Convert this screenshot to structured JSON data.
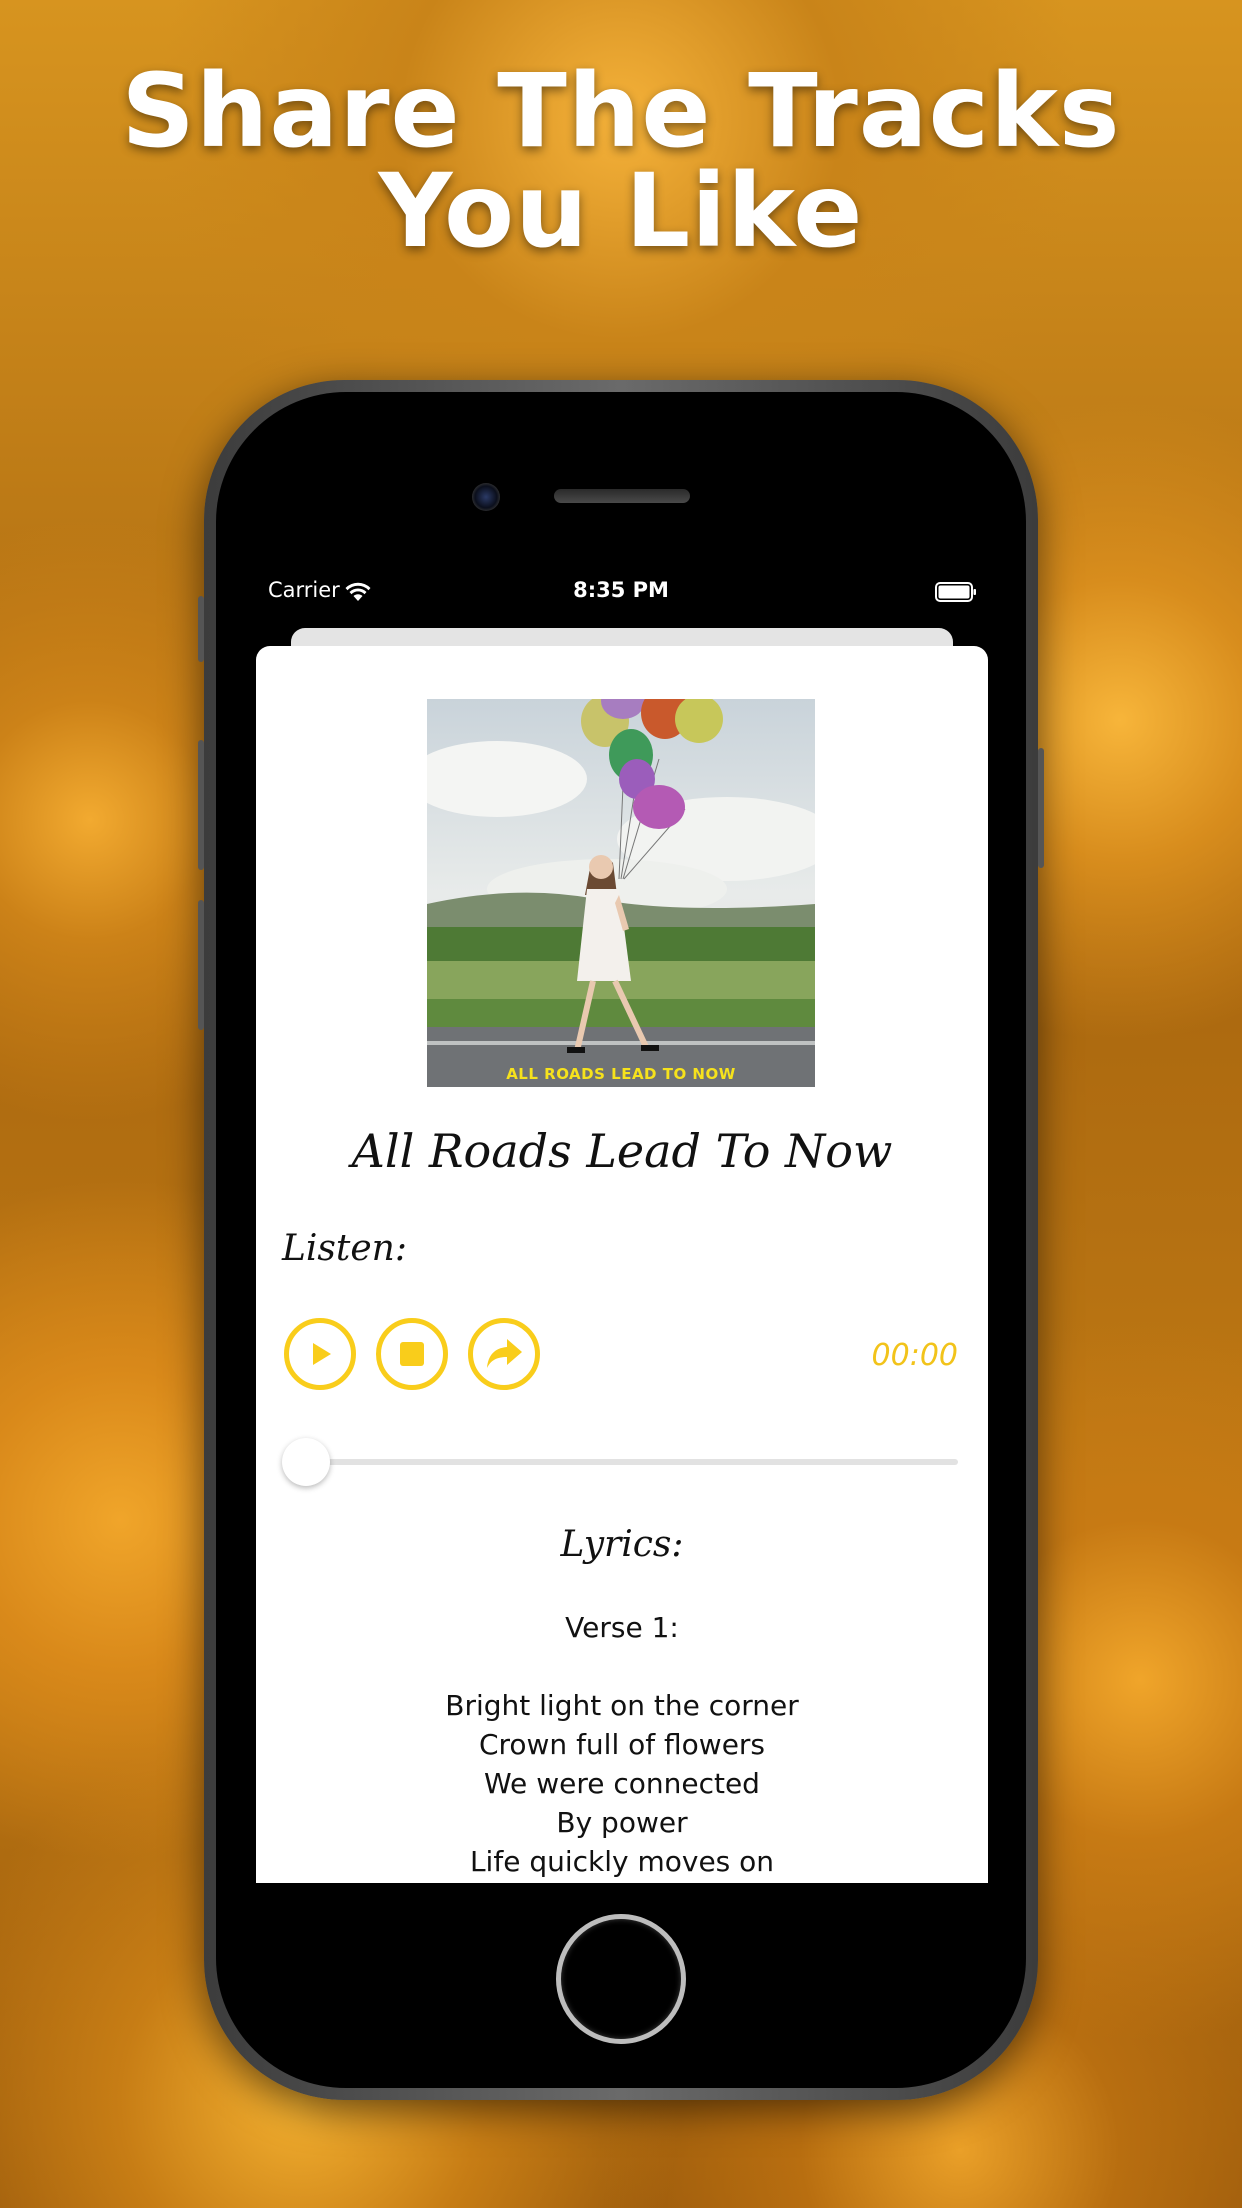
{
  "headline": {
    "line1": "Share The Tracks",
    "line2": "You Like"
  },
  "status_bar": {
    "carrier": "Carrier",
    "time": "8:35 PM",
    "wifi_icon": "wifi-icon",
    "battery_icon": "battery-icon"
  },
  "track": {
    "album_caption": "ALL ROADS LEAD TO NOW",
    "title": "All Roads Lead To Now"
  },
  "player": {
    "listen_label": "Listen:",
    "play_icon": "play-icon",
    "stop_icon": "stop-icon",
    "share_icon": "share-icon",
    "time": "00:00",
    "accent_color": "#f9cd1b",
    "progress": 0
  },
  "lyrics": {
    "label": "Lyrics:",
    "verse_title": "Verse 1:",
    "lines": [
      "Bright light on the corner",
      "Crown full of flowers",
      "We were connected",
      "By power",
      "Life quickly moves on"
    ]
  }
}
